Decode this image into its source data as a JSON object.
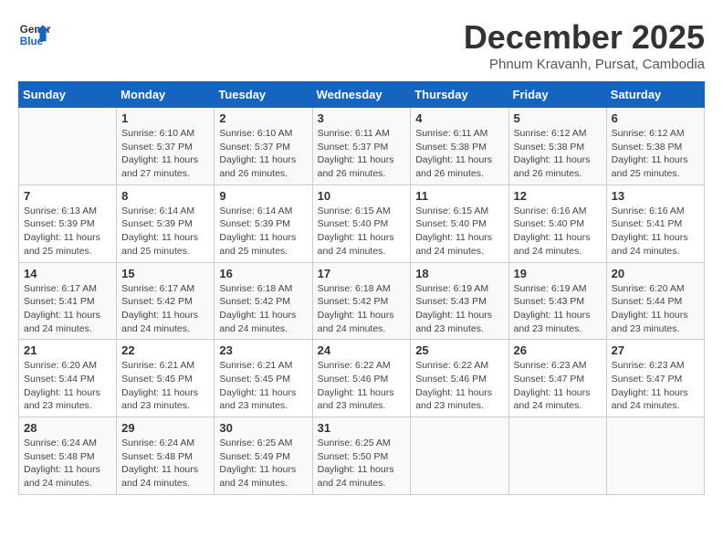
{
  "header": {
    "logo_general": "General",
    "logo_blue": "Blue",
    "month_title": "December 2025",
    "subtitle": "Phnum Kravanh, Pursat, Cambodia"
  },
  "days_of_week": [
    "Sunday",
    "Monday",
    "Tuesday",
    "Wednesday",
    "Thursday",
    "Friday",
    "Saturday"
  ],
  "weeks": [
    [
      {
        "day": "",
        "info": ""
      },
      {
        "day": "1",
        "info": "Sunrise: 6:10 AM\nSunset: 5:37 PM\nDaylight: 11 hours\nand 27 minutes."
      },
      {
        "day": "2",
        "info": "Sunrise: 6:10 AM\nSunset: 5:37 PM\nDaylight: 11 hours\nand 26 minutes."
      },
      {
        "day": "3",
        "info": "Sunrise: 6:11 AM\nSunset: 5:37 PM\nDaylight: 11 hours\nand 26 minutes."
      },
      {
        "day": "4",
        "info": "Sunrise: 6:11 AM\nSunset: 5:38 PM\nDaylight: 11 hours\nand 26 minutes."
      },
      {
        "day": "5",
        "info": "Sunrise: 6:12 AM\nSunset: 5:38 PM\nDaylight: 11 hours\nand 26 minutes."
      },
      {
        "day": "6",
        "info": "Sunrise: 6:12 AM\nSunset: 5:38 PM\nDaylight: 11 hours\nand 25 minutes."
      }
    ],
    [
      {
        "day": "7",
        "info": "Sunrise: 6:13 AM\nSunset: 5:39 PM\nDaylight: 11 hours\nand 25 minutes."
      },
      {
        "day": "8",
        "info": "Sunrise: 6:14 AM\nSunset: 5:39 PM\nDaylight: 11 hours\nand 25 minutes."
      },
      {
        "day": "9",
        "info": "Sunrise: 6:14 AM\nSunset: 5:39 PM\nDaylight: 11 hours\nand 25 minutes."
      },
      {
        "day": "10",
        "info": "Sunrise: 6:15 AM\nSunset: 5:40 PM\nDaylight: 11 hours\nand 24 minutes."
      },
      {
        "day": "11",
        "info": "Sunrise: 6:15 AM\nSunset: 5:40 PM\nDaylight: 11 hours\nand 24 minutes."
      },
      {
        "day": "12",
        "info": "Sunrise: 6:16 AM\nSunset: 5:40 PM\nDaylight: 11 hours\nand 24 minutes."
      },
      {
        "day": "13",
        "info": "Sunrise: 6:16 AM\nSunset: 5:41 PM\nDaylight: 11 hours\nand 24 minutes."
      }
    ],
    [
      {
        "day": "14",
        "info": "Sunrise: 6:17 AM\nSunset: 5:41 PM\nDaylight: 11 hours\nand 24 minutes."
      },
      {
        "day": "15",
        "info": "Sunrise: 6:17 AM\nSunset: 5:42 PM\nDaylight: 11 hours\nand 24 minutes."
      },
      {
        "day": "16",
        "info": "Sunrise: 6:18 AM\nSunset: 5:42 PM\nDaylight: 11 hours\nand 24 minutes."
      },
      {
        "day": "17",
        "info": "Sunrise: 6:18 AM\nSunset: 5:42 PM\nDaylight: 11 hours\nand 24 minutes."
      },
      {
        "day": "18",
        "info": "Sunrise: 6:19 AM\nSunset: 5:43 PM\nDaylight: 11 hours\nand 23 minutes."
      },
      {
        "day": "19",
        "info": "Sunrise: 6:19 AM\nSunset: 5:43 PM\nDaylight: 11 hours\nand 23 minutes."
      },
      {
        "day": "20",
        "info": "Sunrise: 6:20 AM\nSunset: 5:44 PM\nDaylight: 11 hours\nand 23 minutes."
      }
    ],
    [
      {
        "day": "21",
        "info": "Sunrise: 6:20 AM\nSunset: 5:44 PM\nDaylight: 11 hours\nand 23 minutes."
      },
      {
        "day": "22",
        "info": "Sunrise: 6:21 AM\nSunset: 5:45 PM\nDaylight: 11 hours\nand 23 minutes."
      },
      {
        "day": "23",
        "info": "Sunrise: 6:21 AM\nSunset: 5:45 PM\nDaylight: 11 hours\nand 23 minutes."
      },
      {
        "day": "24",
        "info": "Sunrise: 6:22 AM\nSunset: 5:46 PM\nDaylight: 11 hours\nand 23 minutes."
      },
      {
        "day": "25",
        "info": "Sunrise: 6:22 AM\nSunset: 5:46 PM\nDaylight: 11 hours\nand 23 minutes."
      },
      {
        "day": "26",
        "info": "Sunrise: 6:23 AM\nSunset: 5:47 PM\nDaylight: 11 hours\nand 24 minutes."
      },
      {
        "day": "27",
        "info": "Sunrise: 6:23 AM\nSunset: 5:47 PM\nDaylight: 11 hours\nand 24 minutes."
      }
    ],
    [
      {
        "day": "28",
        "info": "Sunrise: 6:24 AM\nSunset: 5:48 PM\nDaylight: 11 hours\nand 24 minutes."
      },
      {
        "day": "29",
        "info": "Sunrise: 6:24 AM\nSunset: 5:48 PM\nDaylight: 11 hours\nand 24 minutes."
      },
      {
        "day": "30",
        "info": "Sunrise: 6:25 AM\nSunset: 5:49 PM\nDaylight: 11 hours\nand 24 minutes."
      },
      {
        "day": "31",
        "info": "Sunrise: 6:25 AM\nSunset: 5:50 PM\nDaylight: 11 hours\nand 24 minutes."
      },
      {
        "day": "",
        "info": ""
      },
      {
        "day": "",
        "info": ""
      },
      {
        "day": "",
        "info": ""
      }
    ]
  ]
}
